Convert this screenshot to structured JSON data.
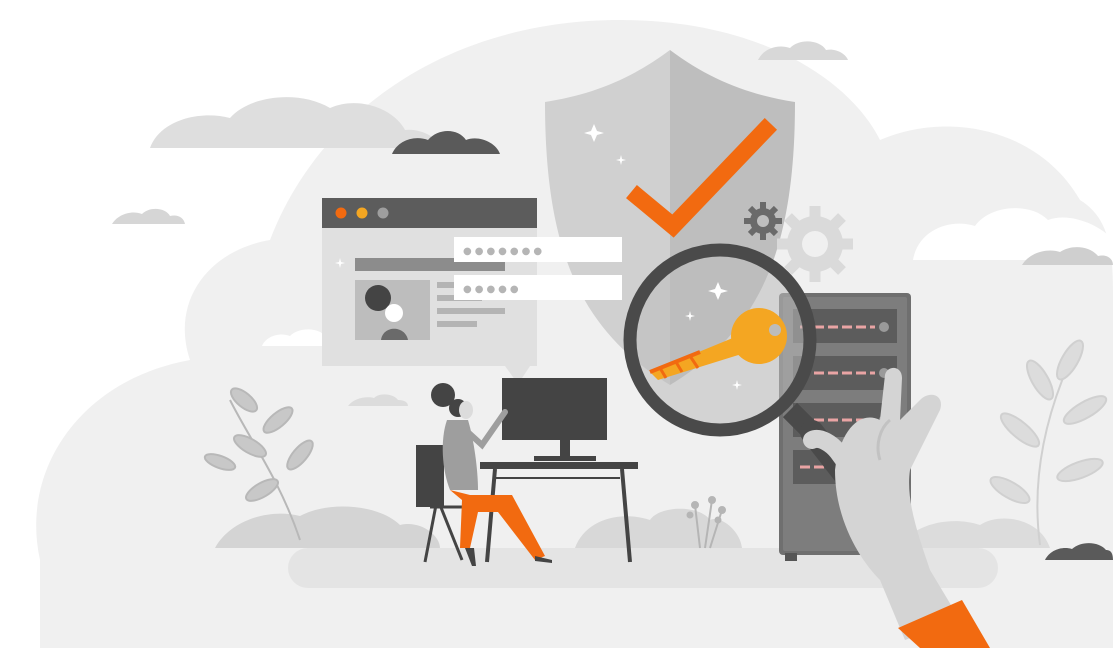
{
  "illustration": {
    "theme": "security-audit",
    "colors": {
      "background": "#ffffff",
      "cloud_light": "#f0f0f0",
      "cloud_mid": "#dcdcdc",
      "cloud_dark": "#5e5e5e",
      "shield_left": "#d2d2d2",
      "shield_right": "#bdbdbd",
      "accent_orange": "#f26a10",
      "key_yellow": "#f4a622",
      "dark": "#444444",
      "server": "#6e6e6e",
      "led_pink": "#e9a4a4"
    },
    "login_window": {
      "title_dots": [
        "#f26a10",
        "#f4a622",
        "#9e9e9e"
      ],
      "password_mask_1": "●●●●●●●",
      "password_mask_2": "●●●●●"
    },
    "icons": [
      "shield-icon",
      "checkmark-icon",
      "key-icon",
      "magnifier-icon",
      "gear-icon",
      "server-icon",
      "browser-window-icon",
      "person-at-desk",
      "hand-icon",
      "sparkle-icon",
      "plant-icon",
      "cloud-icon"
    ]
  }
}
